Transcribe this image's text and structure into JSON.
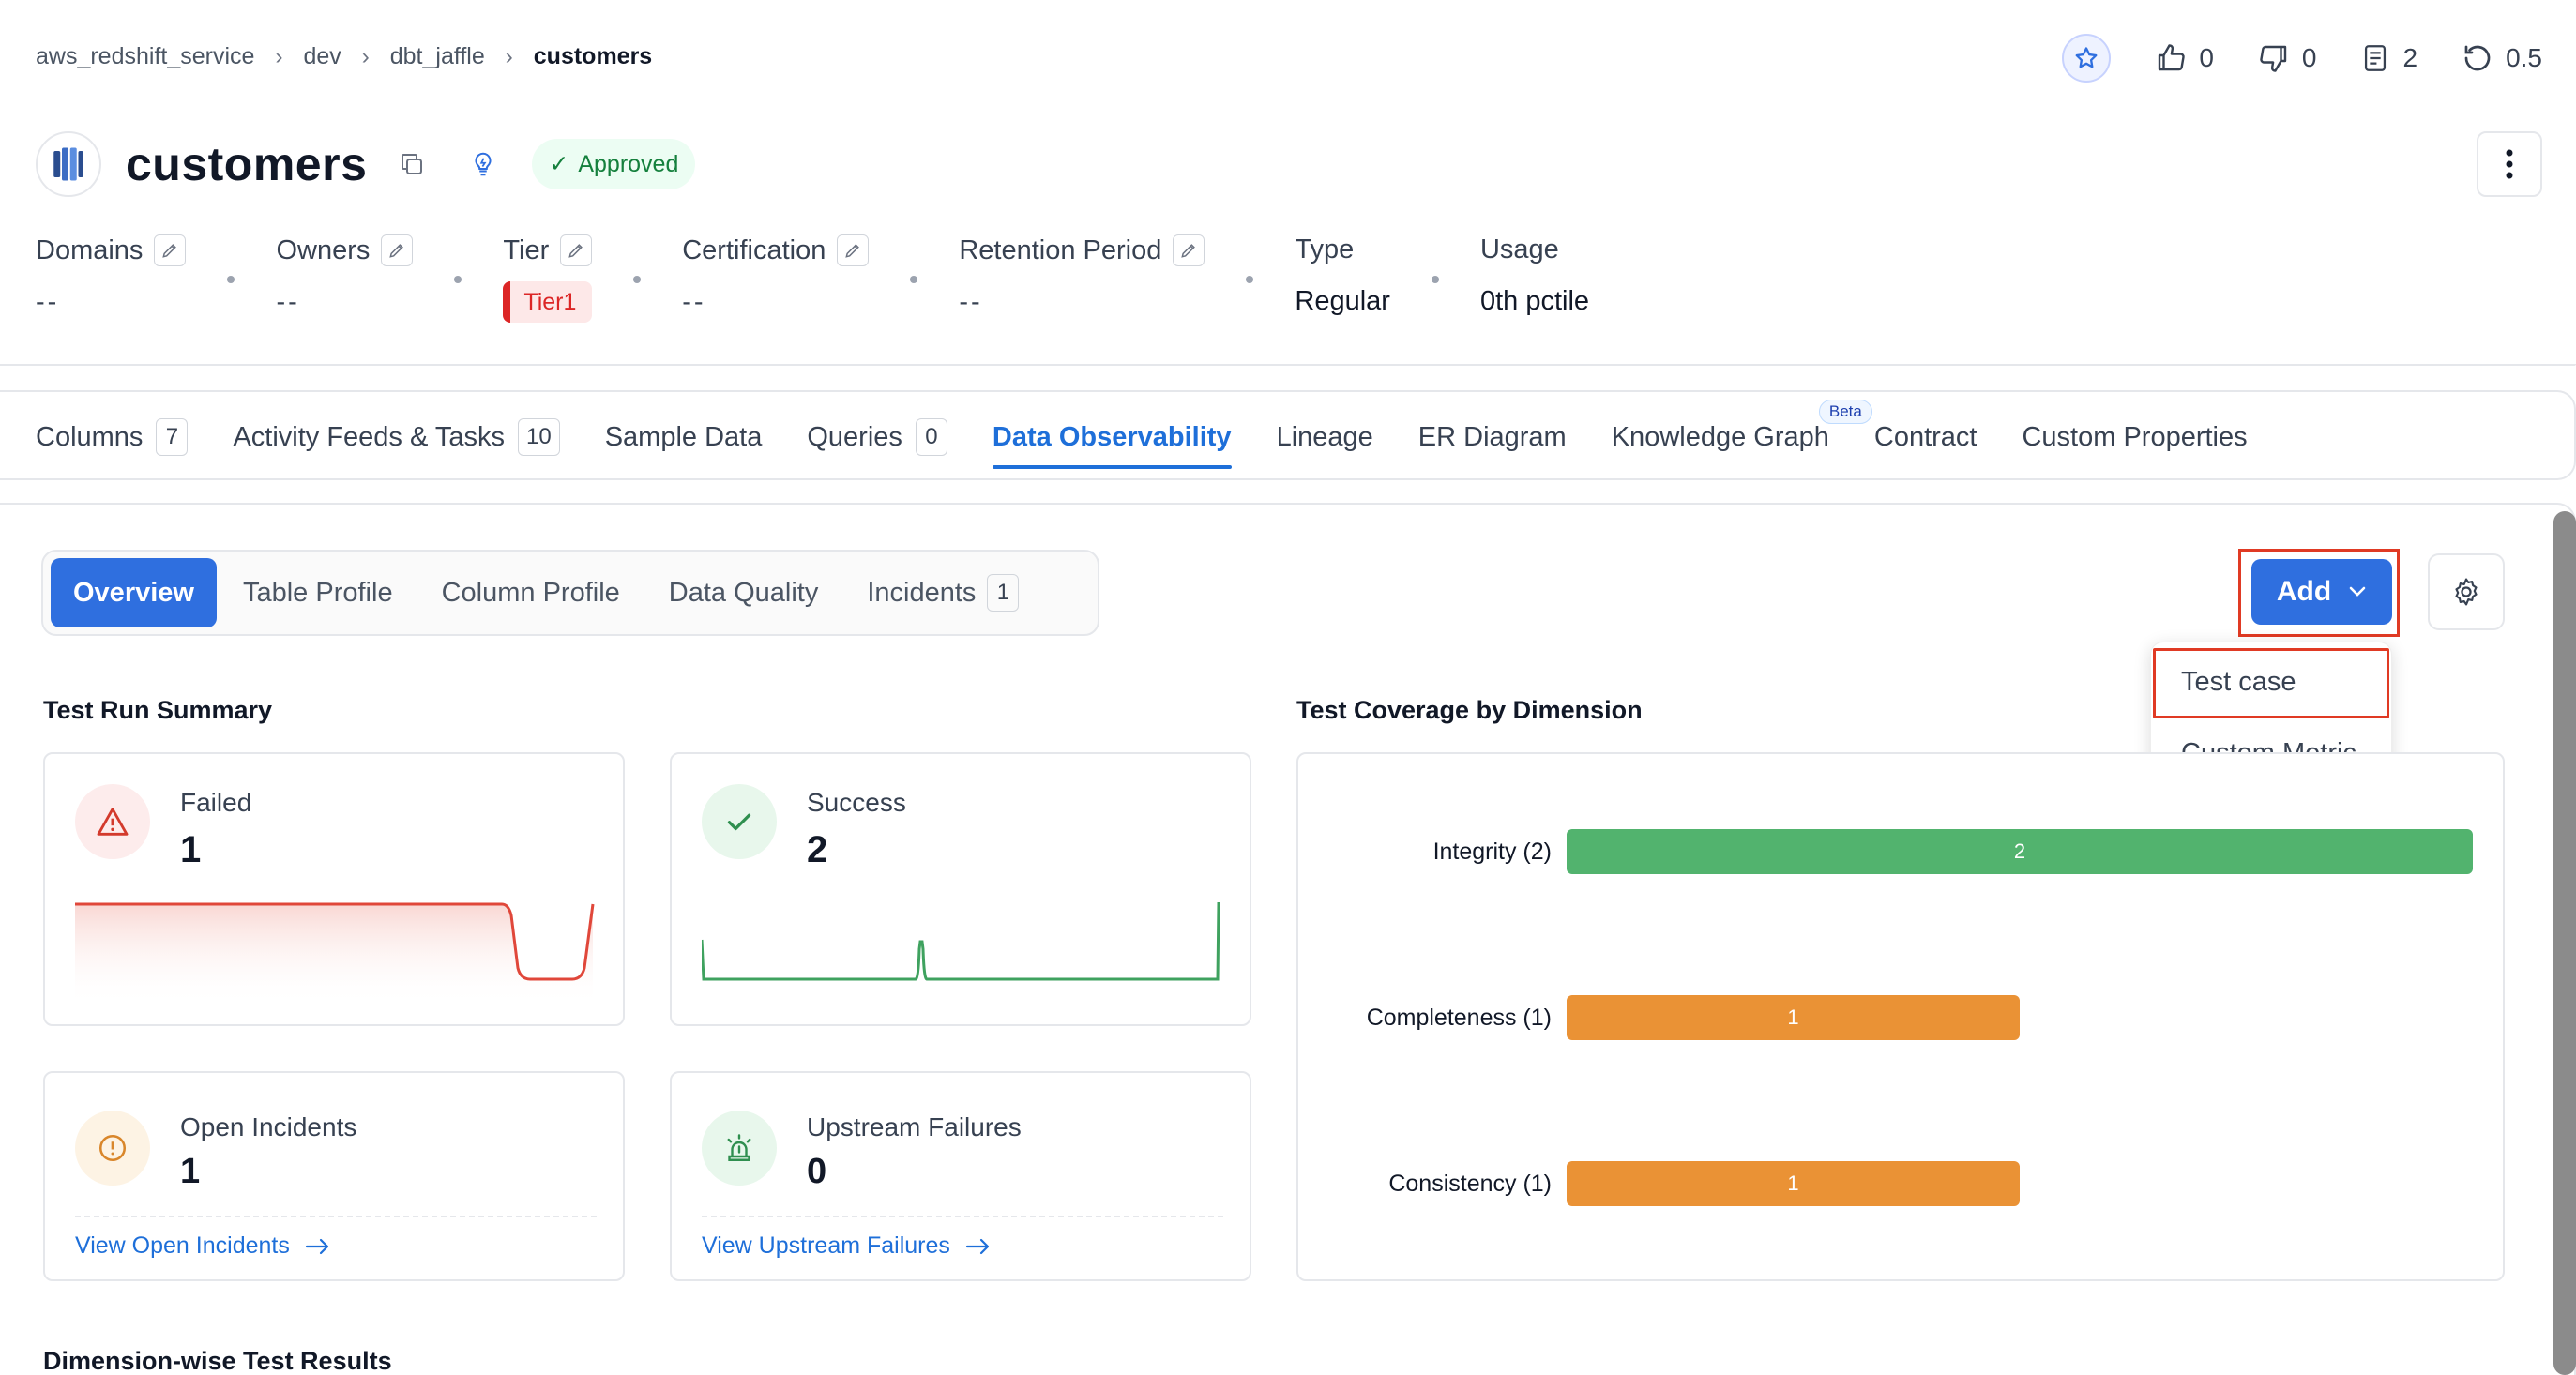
{
  "breadcrumb": {
    "items": [
      "aws_redshift_service",
      "dev",
      "dbt_jaffle"
    ],
    "current": "customers"
  },
  "top_actions": {
    "likes": "0",
    "dislikes": "0",
    "docs": "2",
    "version": "0.5"
  },
  "entity": {
    "title": "customers",
    "status": "Approved"
  },
  "meta": {
    "domains": {
      "label": "Domains",
      "value": "--"
    },
    "owners": {
      "label": "Owners",
      "value": "--"
    },
    "tier": {
      "label": "Tier",
      "value": "Tier1"
    },
    "certification": {
      "label": "Certification",
      "value": "--"
    },
    "retention": {
      "label": "Retention Period",
      "value": "--"
    },
    "type": {
      "label": "Type",
      "value": "Regular"
    },
    "usage": {
      "label": "Usage",
      "value": "0th pctile"
    }
  },
  "tabs": [
    {
      "label": "Columns",
      "count": "7"
    },
    {
      "label": "Activity Feeds & Tasks",
      "count": "10"
    },
    {
      "label": "Sample Data"
    },
    {
      "label": "Queries",
      "count": "0"
    },
    {
      "label": "Data Observability"
    },
    {
      "label": "Lineage"
    },
    {
      "label": "ER Diagram"
    },
    {
      "label": "Knowledge Graph",
      "badge": "Beta"
    },
    {
      "label": "Contract"
    },
    {
      "label": "Custom Properties"
    }
  ],
  "sub_tabs": [
    {
      "label": "Overview"
    },
    {
      "label": "Table Profile"
    },
    {
      "label": "Column Profile"
    },
    {
      "label": "Data Quality"
    },
    {
      "label": "Incidents",
      "count": "1"
    }
  ],
  "add_button": {
    "label": "Add"
  },
  "dropdown": {
    "items": [
      "Test case",
      "Custom Metric"
    ]
  },
  "summary": {
    "title": "Test Run Summary",
    "failed": {
      "label": "Failed",
      "value": "1"
    },
    "success": {
      "label": "Success",
      "value": "2"
    },
    "open_incidents": {
      "label": "Open Incidents",
      "value": "1",
      "link": "View Open Incidents"
    },
    "upstream": {
      "label": "Upstream Failures",
      "value": "0",
      "link": "View Upstream Failures"
    }
  },
  "coverage": {
    "title": "Test Coverage by Dimension"
  },
  "dimension_results": {
    "title": "Dimension-wise Test Results"
  },
  "chart_data": {
    "type": "bar",
    "title": "Test Coverage by Dimension",
    "categories": [
      "Integrity (2)",
      "Completeness (1)",
      "Consistency (1)"
    ],
    "values": [
      2,
      1,
      1
    ],
    "colors": [
      "#52b36e",
      "#ea9235",
      "#ea9235"
    ],
    "orientation": "horizontal"
  },
  "colors": {
    "accent": "#2f6fdf",
    "failed": "#e0473a",
    "success": "#3fa25f",
    "warning": "#e08a1e",
    "highlight": "#e03a24"
  }
}
